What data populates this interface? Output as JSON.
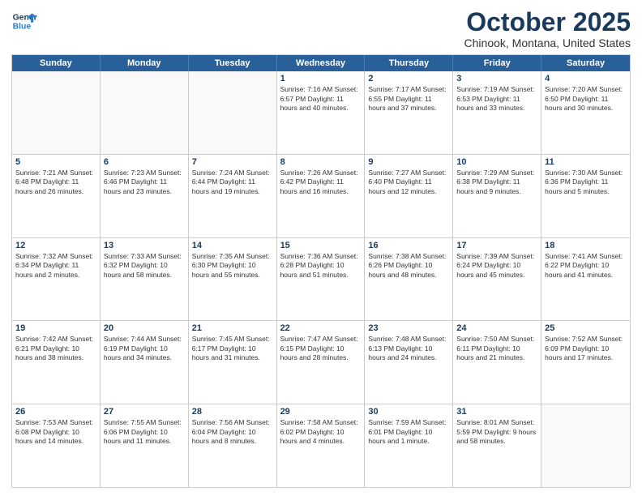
{
  "header": {
    "logo_line1": "General",
    "logo_line2": "Blue",
    "month": "October 2025",
    "location": "Chinook, Montana, United States"
  },
  "days_of_week": [
    "Sunday",
    "Monday",
    "Tuesday",
    "Wednesday",
    "Thursday",
    "Friday",
    "Saturday"
  ],
  "weeks": [
    [
      {
        "day": "",
        "content": ""
      },
      {
        "day": "",
        "content": ""
      },
      {
        "day": "",
        "content": ""
      },
      {
        "day": "1",
        "content": "Sunrise: 7:16 AM\nSunset: 6:57 PM\nDaylight: 11 hours\nand 40 minutes."
      },
      {
        "day": "2",
        "content": "Sunrise: 7:17 AM\nSunset: 6:55 PM\nDaylight: 11 hours\nand 37 minutes."
      },
      {
        "day": "3",
        "content": "Sunrise: 7:19 AM\nSunset: 6:53 PM\nDaylight: 11 hours\nand 33 minutes."
      },
      {
        "day": "4",
        "content": "Sunrise: 7:20 AM\nSunset: 6:50 PM\nDaylight: 11 hours\nand 30 minutes."
      }
    ],
    [
      {
        "day": "5",
        "content": "Sunrise: 7:21 AM\nSunset: 6:48 PM\nDaylight: 11 hours\nand 26 minutes."
      },
      {
        "day": "6",
        "content": "Sunrise: 7:23 AM\nSunset: 6:46 PM\nDaylight: 11 hours\nand 23 minutes."
      },
      {
        "day": "7",
        "content": "Sunrise: 7:24 AM\nSunset: 6:44 PM\nDaylight: 11 hours\nand 19 minutes."
      },
      {
        "day": "8",
        "content": "Sunrise: 7:26 AM\nSunset: 6:42 PM\nDaylight: 11 hours\nand 16 minutes."
      },
      {
        "day": "9",
        "content": "Sunrise: 7:27 AM\nSunset: 6:40 PM\nDaylight: 11 hours\nand 12 minutes."
      },
      {
        "day": "10",
        "content": "Sunrise: 7:29 AM\nSunset: 6:38 PM\nDaylight: 11 hours\nand 9 minutes."
      },
      {
        "day": "11",
        "content": "Sunrise: 7:30 AM\nSunset: 6:36 PM\nDaylight: 11 hours\nand 5 minutes."
      }
    ],
    [
      {
        "day": "12",
        "content": "Sunrise: 7:32 AM\nSunset: 6:34 PM\nDaylight: 11 hours\nand 2 minutes."
      },
      {
        "day": "13",
        "content": "Sunrise: 7:33 AM\nSunset: 6:32 PM\nDaylight: 10 hours\nand 58 minutes."
      },
      {
        "day": "14",
        "content": "Sunrise: 7:35 AM\nSunset: 6:30 PM\nDaylight: 10 hours\nand 55 minutes."
      },
      {
        "day": "15",
        "content": "Sunrise: 7:36 AM\nSunset: 6:28 PM\nDaylight: 10 hours\nand 51 minutes."
      },
      {
        "day": "16",
        "content": "Sunrise: 7:38 AM\nSunset: 6:26 PM\nDaylight: 10 hours\nand 48 minutes."
      },
      {
        "day": "17",
        "content": "Sunrise: 7:39 AM\nSunset: 6:24 PM\nDaylight: 10 hours\nand 45 minutes."
      },
      {
        "day": "18",
        "content": "Sunrise: 7:41 AM\nSunset: 6:22 PM\nDaylight: 10 hours\nand 41 minutes."
      }
    ],
    [
      {
        "day": "19",
        "content": "Sunrise: 7:42 AM\nSunset: 6:21 PM\nDaylight: 10 hours\nand 38 minutes."
      },
      {
        "day": "20",
        "content": "Sunrise: 7:44 AM\nSunset: 6:19 PM\nDaylight: 10 hours\nand 34 minutes."
      },
      {
        "day": "21",
        "content": "Sunrise: 7:45 AM\nSunset: 6:17 PM\nDaylight: 10 hours\nand 31 minutes."
      },
      {
        "day": "22",
        "content": "Sunrise: 7:47 AM\nSunset: 6:15 PM\nDaylight: 10 hours\nand 28 minutes."
      },
      {
        "day": "23",
        "content": "Sunrise: 7:48 AM\nSunset: 6:13 PM\nDaylight: 10 hours\nand 24 minutes."
      },
      {
        "day": "24",
        "content": "Sunrise: 7:50 AM\nSunset: 6:11 PM\nDaylight: 10 hours\nand 21 minutes."
      },
      {
        "day": "25",
        "content": "Sunrise: 7:52 AM\nSunset: 6:09 PM\nDaylight: 10 hours\nand 17 minutes."
      }
    ],
    [
      {
        "day": "26",
        "content": "Sunrise: 7:53 AM\nSunset: 6:08 PM\nDaylight: 10 hours\nand 14 minutes."
      },
      {
        "day": "27",
        "content": "Sunrise: 7:55 AM\nSunset: 6:06 PM\nDaylight: 10 hours\nand 11 minutes."
      },
      {
        "day": "28",
        "content": "Sunrise: 7:56 AM\nSunset: 6:04 PM\nDaylight: 10 hours\nand 8 minutes."
      },
      {
        "day": "29",
        "content": "Sunrise: 7:58 AM\nSunset: 6:02 PM\nDaylight: 10 hours\nand 4 minutes."
      },
      {
        "day": "30",
        "content": "Sunrise: 7:59 AM\nSunset: 6:01 PM\nDaylight: 10 hours\nand 1 minute."
      },
      {
        "day": "31",
        "content": "Sunrise: 8:01 AM\nSunset: 5:59 PM\nDaylight: 9 hours\nand 58 minutes."
      },
      {
        "day": "",
        "content": ""
      }
    ]
  ]
}
